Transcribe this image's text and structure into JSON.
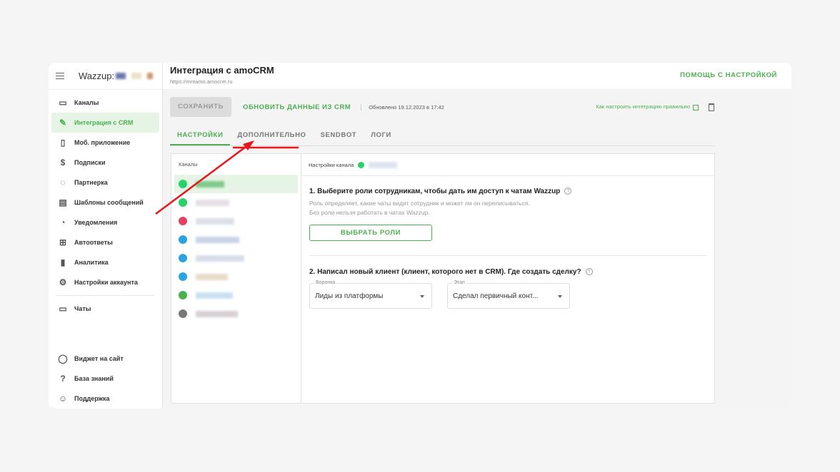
{
  "sidebar": {
    "brand": "Wazzup:",
    "items": [
      {
        "label": "Каналы",
        "icon": "devices-icon"
      },
      {
        "label": "Интеграция с CRM",
        "icon": "plug-icon",
        "active": true
      },
      {
        "label": "Моб. приложение",
        "icon": "phone-icon"
      },
      {
        "label": "Подписки",
        "icon": "dollar-icon"
      },
      {
        "label": "Партнерка",
        "icon": "handshake-icon"
      },
      {
        "label": "Шаблоны сообщений",
        "icon": "template-icon"
      },
      {
        "label": "Уведомления",
        "icon": "bell-icon"
      },
      {
        "label": "Автоответы",
        "icon": "autoreply-icon"
      },
      {
        "label": "Аналитика",
        "icon": "chart-icon"
      },
      {
        "label": "Настройки аккаунта",
        "icon": "gear-icon"
      }
    ],
    "chats": "Чаты",
    "bottom": [
      {
        "label": "Виджет на сайт"
      },
      {
        "label": "База знаний"
      },
      {
        "label": "Поддержка"
      }
    ]
  },
  "header": {
    "title": "Интеграция с amoCRM",
    "url": "https://mntamo.amocrm.ru",
    "help": "ПОМОЩЬ С НАСТРОЙКОЙ"
  },
  "toolbar": {
    "save": "СОХРАНИТЬ",
    "update": "ОБНОВИТЬ ДАННЫЕ ИЗ CRM",
    "updated": "Обновлено 19.12.2023 в 17:42",
    "howto": "Как настроить интеграцию правильно"
  },
  "tabs": [
    "НАСТРОЙКИ",
    "ДОПОЛНИТЕЛЬНО",
    "SENDBOT",
    "ЛОГИ"
  ],
  "channels": {
    "title": "Каналы",
    "colors": [
      "#25d366",
      "#25d366",
      "#e4405f",
      "#2aa3e0",
      "#2aa3e0",
      "#2aa3e0",
      "#4caf50",
      "#777777"
    ]
  },
  "settings": {
    "title": "Настройки канала",
    "s1": "1. Выберите роли сотрудникам, чтобы дать им доступ к чатам Wazzup",
    "d1": "Роль определяет, какие чаты видит сотрудник и может ли он переписываться.",
    "d2": "Без роли нельзя работать в чатах Wazzup.",
    "roles": "ВЫБРАТЬ РОЛИ",
    "s2": "2. Написал новый клиент (клиент, которого нет в CRM). Где создать сделку?",
    "funnel_label": "Воронка",
    "funnel": "Лиды из платформы",
    "stage_label": "Этап",
    "stage": "Сделал первичный конт..."
  },
  "accent": "#4caf50"
}
